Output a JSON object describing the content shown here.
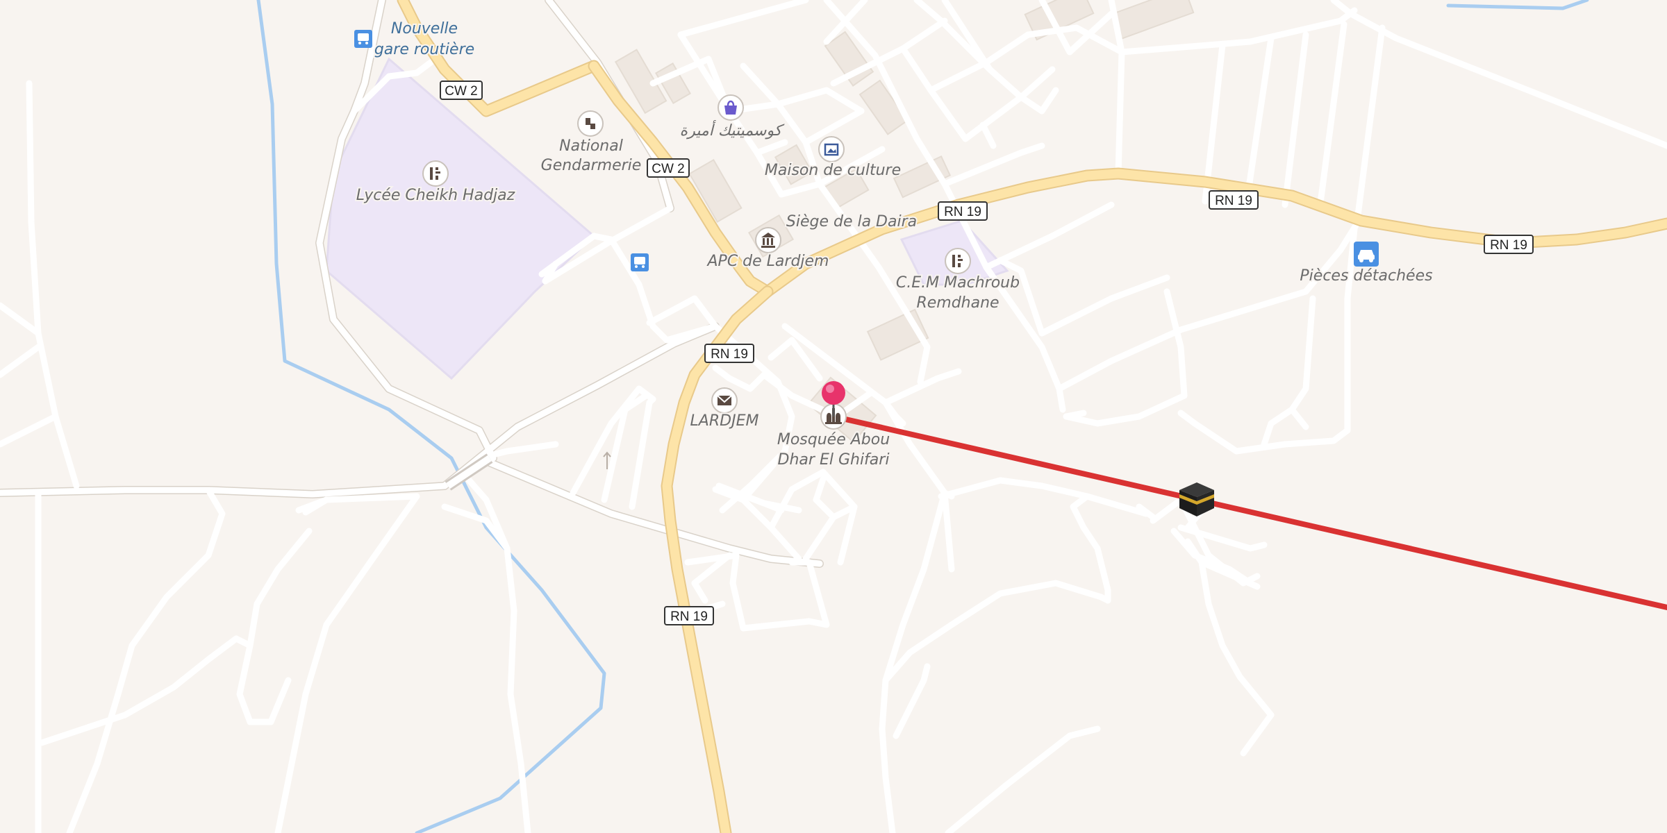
{
  "map": {
    "route_color": "#d93232",
    "marker_color": "#e8336b",
    "water_color": "#a9cdf0",
    "major_road_color": "#fde4a8",
    "road_shields": [
      "CW 2",
      "CW 2",
      "RN 19",
      "RN 19",
      "RN 19",
      "RN 19",
      "RN 19"
    ],
    "labels": {
      "bus_station": [
        "Nouvelle",
        "gare routière"
      ],
      "gendarmerie": [
        "National",
        "Gendarmerie"
      ],
      "lycee": "Lycée Cheikh Hadjaz",
      "shop_arabic": "كوسميتيك أميرة",
      "maison_culture": "Maison de culture",
      "siege_daira": "Siège de la Daira",
      "apc": "APC de Lardjem",
      "cem": [
        "C.E.M Machroub",
        "Remdhane"
      ],
      "pieces": "Pièces détachées",
      "post": "LARDJEM",
      "mosque": [
        "Mosquée Abou",
        "Dhar El Ghifari"
      ]
    },
    "icons": {
      "bus_station": "bus-icon",
      "bus_stop": "bus-icon",
      "gendarmerie": "police-icon",
      "lycee": "school-icon",
      "shop": "shopping-bag-icon",
      "culture": "gallery-icon",
      "townhall": "townhall-icon",
      "cem": "school-icon",
      "car_parts": "car-icon",
      "post": "envelope-icon",
      "mosque": "mosque-icon",
      "kaaba": "kaaba-icon",
      "pin": "map-pin-icon"
    }
  }
}
